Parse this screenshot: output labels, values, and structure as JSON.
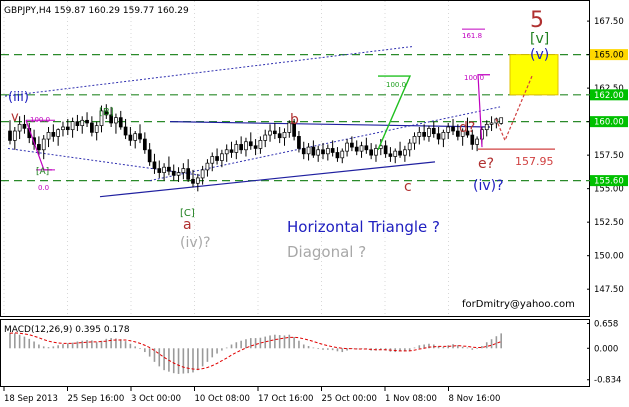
{
  "chart_data": {
    "type": "candlestick",
    "header": "GBPJPY,H4  159.87 160.29 159.77 160.29",
    "y_axis": {
      "min": 145.5,
      "max": 169.0,
      "ticks": [
        "167.50",
        "165.00",
        "162.50",
        "160.00",
        "157.50",
        "155.00",
        "152.50",
        "150.00",
        "147.50"
      ],
      "tick_values": [
        167.5,
        165.0,
        162.5,
        160.0,
        157.5,
        155.0,
        152.5,
        150.0,
        147.5
      ]
    },
    "x_axis": {
      "labels": [
        "18 Sep 2013",
        "25 Sep 16:00",
        "3 Oct 00:00",
        "10 Oct 08:00",
        "17 Oct 16:00",
        "25 Oct 00:00",
        "1 Nov 08:00",
        "8 Nov 16:00"
      ]
    },
    "price_tags": [
      {
        "value": 165.0,
        "text": "165.00",
        "color": "#ffd800"
      },
      {
        "value": 162.0,
        "text": "162.00",
        "color": "#00c000"
      },
      {
        "value": 160.0,
        "text": "160.00",
        "color": "#00c000"
      },
      {
        "value": 155.6,
        "text": "155.60",
        "color": "#00c000"
      }
    ],
    "price_series": [
      [
        0,
        159.3,
        160.1,
        158.3,
        158.6
      ],
      [
        1,
        158.6,
        159.6,
        157.9,
        159.3
      ],
      [
        2,
        159.3,
        160.4,
        158.7,
        159.8
      ],
      [
        3,
        159.8,
        160.5,
        159.1,
        159.5
      ],
      [
        4,
        159.5,
        159.9,
        158.4,
        158.8
      ],
      [
        5,
        158.8,
        159.4,
        157.9,
        158.3
      ],
      [
        6,
        158.3,
        158.9,
        157.5,
        157.9
      ],
      [
        7,
        157.9,
        159.0,
        157.2,
        158.7
      ],
      [
        8,
        158.7,
        159.6,
        158.1,
        159.2
      ],
      [
        9,
        159.2,
        159.8,
        158.5,
        158.9
      ],
      [
        10,
        158.9,
        159.5,
        158.2,
        159.4
      ],
      [
        11,
        159.4,
        160.0,
        158.9,
        159.6
      ],
      [
        12,
        159.6,
        160.2,
        159.0,
        159.4
      ],
      [
        13,
        159.4,
        160.3,
        158.8,
        160.0
      ],
      [
        14,
        160.0,
        160.5,
        159.3,
        159.7
      ],
      [
        15,
        159.7,
        160.4,
        159.1,
        160.1
      ],
      [
        16,
        160.1,
        160.7,
        159.6,
        159.9
      ],
      [
        17,
        159.9,
        160.4,
        158.9,
        159.2
      ],
      [
        18,
        159.2,
        160.0,
        158.6,
        159.7
      ],
      [
        19,
        159.7,
        161.2,
        159.2,
        160.8
      ],
      [
        20,
        160.8,
        161.3,
        160.2,
        160.5
      ],
      [
        21,
        160.5,
        161.1,
        159.6,
        159.9
      ],
      [
        22,
        159.9,
        160.6,
        159.1,
        160.3
      ],
      [
        23,
        160.3,
        160.8,
        159.4,
        159.6
      ],
      [
        24,
        159.6,
        160.2,
        158.7,
        159.0
      ],
      [
        25,
        159.0,
        159.6,
        158.2,
        158.6
      ],
      [
        26,
        158.6,
        159.3,
        158.0,
        159.1
      ],
      [
        27,
        159.1,
        159.8,
        158.4,
        158.7
      ],
      [
        28,
        158.7,
        159.2,
        157.6,
        157.9
      ],
      [
        29,
        157.9,
        158.4,
        156.7,
        157.0
      ],
      [
        30,
        157.0,
        157.6,
        156.1,
        156.5
      ],
      [
        31,
        156.5,
        157.1,
        155.8,
        156.2
      ],
      [
        32,
        156.2,
        156.9,
        155.6,
        156.6
      ],
      [
        33,
        156.6,
        157.4,
        156.0,
        156.3
      ],
      [
        34,
        156.3,
        156.8,
        155.6,
        156.0
      ],
      [
        35,
        156.0,
        156.6,
        155.5,
        156.2
      ],
      [
        36,
        156.2,
        156.9,
        155.7,
        156.5
      ],
      [
        37,
        156.5,
        157.2,
        155.5,
        155.7
      ],
      [
        38,
        155.7,
        156.4,
        155.1,
        155.4
      ],
      [
        39,
        155.4,
        156.1,
        154.8,
        155.8
      ],
      [
        40,
        155.8,
        156.7,
        155.3,
        156.4
      ],
      [
        41,
        156.4,
        157.2,
        155.9,
        156.9
      ],
      [
        42,
        156.9,
        157.7,
        156.3,
        157.4
      ],
      [
        43,
        157.4,
        158.0,
        156.8,
        157.1
      ],
      [
        44,
        157.1,
        157.9,
        156.6,
        157.6
      ],
      [
        45,
        157.6,
        158.3,
        157.0,
        157.9
      ],
      [
        46,
        157.9,
        158.5,
        157.3,
        157.7
      ],
      [
        47,
        157.7,
        158.6,
        157.2,
        158.3
      ],
      [
        48,
        158.3,
        158.9,
        157.6,
        157.9
      ],
      [
        49,
        157.9,
        158.8,
        157.4,
        158.5
      ],
      [
        50,
        158.5,
        159.2,
        157.9,
        158.2
      ],
      [
        51,
        158.2,
        158.7,
        157.5,
        158.0
      ],
      [
        52,
        158.0,
        158.9,
        157.6,
        158.6
      ],
      [
        53,
        158.6,
        159.4,
        158.1,
        159.0
      ],
      [
        54,
        159.0,
        159.8,
        158.5,
        159.3
      ],
      [
        55,
        159.3,
        159.9,
        158.7,
        159.1
      ],
      [
        56,
        159.1,
        159.6,
        158.4,
        158.8
      ],
      [
        57,
        158.8,
        159.5,
        158.2,
        159.2
      ],
      [
        58,
        159.2,
        160.1,
        158.8,
        159.9
      ],
      [
        59,
        159.9,
        160.2,
        158.6,
        158.9
      ],
      [
        60,
        158.9,
        159.3,
        157.7,
        158.0
      ],
      [
        61,
        158.0,
        158.5,
        157.2,
        157.6
      ],
      [
        62,
        157.6,
        158.4,
        157.1,
        158.1
      ],
      [
        63,
        158.1,
        158.6,
        157.3,
        157.5
      ],
      [
        64,
        157.5,
        158.2,
        157.0,
        157.9
      ],
      [
        65,
        157.9,
        158.4,
        157.2,
        157.6
      ],
      [
        66,
        157.6,
        158.3,
        157.1,
        158.0
      ],
      [
        67,
        158.0,
        158.6,
        157.4,
        157.7
      ],
      [
        68,
        157.7,
        158.1,
        157.0,
        157.3
      ],
      [
        69,
        157.3,
        158.0,
        156.9,
        157.8
      ],
      [
        70,
        157.8,
        158.7,
        157.4,
        158.4
      ],
      [
        71,
        158.4,
        158.9,
        157.8,
        158.1
      ],
      [
        72,
        158.1,
        158.6,
        157.5,
        157.8
      ],
      [
        73,
        157.8,
        158.5,
        157.3,
        158.2
      ],
      [
        74,
        158.2,
        158.8,
        157.6,
        157.9
      ],
      [
        75,
        157.9,
        158.4,
        157.2,
        157.5
      ],
      [
        76,
        157.5,
        158.3,
        157.0,
        158.0
      ],
      [
        77,
        158.0,
        158.7,
        157.5,
        158.2
      ],
      [
        78,
        158.2,
        158.6,
        157.3,
        157.6
      ],
      [
        79,
        157.6,
        158.1,
        157.0,
        157.4
      ],
      [
        80,
        157.4,
        158.0,
        156.9,
        157.8
      ],
      [
        81,
        157.8,
        158.5,
        157.3,
        157.5
      ],
      [
        82,
        157.5,
        158.2,
        157.0,
        157.9
      ],
      [
        83,
        157.9,
        158.7,
        157.4,
        158.4
      ],
      [
        84,
        158.4,
        159.2,
        157.9,
        158.9
      ],
      [
        85,
        158.9,
        159.6,
        158.3,
        159.2
      ],
      [
        86,
        159.2,
        159.8,
        158.6,
        158.9
      ],
      [
        87,
        158.9,
        159.7,
        158.5,
        159.5
      ],
      [
        88,
        159.5,
        160.0,
        158.8,
        159.1
      ],
      [
        89,
        159.1,
        159.6,
        158.3,
        158.7
      ],
      [
        90,
        158.7,
        159.4,
        158.1,
        159.2
      ],
      [
        91,
        159.2,
        159.9,
        158.7,
        159.6
      ],
      [
        92,
        159.6,
        160.2,
        159.0,
        159.3
      ],
      [
        93,
        159.3,
        159.8,
        158.6,
        158.9
      ],
      [
        94,
        158.9,
        159.5,
        158.2,
        159.3
      ],
      [
        95,
        159.3,
        160.3,
        158.8,
        159.0
      ],
      [
        96,
        159.0,
        159.4,
        157.9,
        158.3
      ],
      [
        97,
        158.3,
        158.9,
        157.8,
        158.7
      ],
      [
        98,
        158.7,
        159.6,
        158.3,
        159.4
      ],
      [
        99,
        159.4,
        160.1,
        158.9,
        159.8
      ],
      [
        100,
        159.8,
        160.4,
        159.3,
        159.9
      ],
      [
        101,
        159.9,
        160.3,
        159.5,
        160.2
      ],
      [
        102,
        159.87,
        160.29,
        159.77,
        160.29
      ]
    ],
    "macd": {
      "label": "MACD(12,26,9) 0.395 0.178",
      "min": -1.0,
      "max": 0.75,
      "ticks": [
        "0.658",
        "0.000",
        "-0.834"
      ],
      "tick_values": [
        0.658,
        0.0,
        -0.834
      ],
      "histogram": [
        0.42,
        0.4,
        0.36,
        0.31,
        0.25,
        0.18,
        0.1,
        0.05,
        0.03,
        0.05,
        0.08,
        0.11,
        0.13,
        0.15,
        0.18,
        0.2,
        0.22,
        0.21,
        0.16,
        0.2,
        0.25,
        0.27,
        0.26,
        0.24,
        0.19,
        0.12,
        0.05,
        -0.02,
        -0.1,
        -0.22,
        -0.36,
        -0.48,
        -0.58,
        -0.62,
        -0.66,
        -0.68,
        -0.67,
        -0.66,
        -0.64,
        -0.58,
        -0.48,
        -0.36,
        -0.24,
        -0.14,
        -0.06,
        0.02,
        0.1,
        0.16,
        0.2,
        0.24,
        0.27,
        0.27,
        0.28,
        0.31,
        0.34,
        0.36,
        0.35,
        0.34,
        0.36,
        0.3,
        0.2,
        0.1,
        0.06,
        0.02,
        -0.02,
        -0.04,
        -0.04,
        -0.05,
        -0.08,
        -0.1,
        -0.06,
        -0.02,
        -0.03,
        -0.02,
        -0.03,
        -0.06,
        -0.06,
        -0.04,
        -0.06,
        -0.09,
        -0.1,
        -0.08,
        -0.08,
        -0.06,
        0.02,
        0.08,
        0.1,
        0.12,
        0.1,
        0.06,
        0.04,
        0.08,
        0.11,
        0.08,
        0.04,
        0.02,
        -0.04,
        -0.02,
        0.06,
        0.16,
        0.24,
        0.32,
        0.395
      ],
      "signal": [
        0.4,
        0.41,
        0.4,
        0.38,
        0.36,
        0.32,
        0.28,
        0.23,
        0.19,
        0.16,
        0.14,
        0.13,
        0.13,
        0.13,
        0.14,
        0.15,
        0.16,
        0.17,
        0.17,
        0.18,
        0.19,
        0.21,
        0.22,
        0.22,
        0.22,
        0.2,
        0.17,
        0.13,
        0.08,
        0.02,
        -0.06,
        -0.15,
        -0.24,
        -0.32,
        -0.39,
        -0.45,
        -0.5,
        -0.53,
        -0.55,
        -0.56,
        -0.54,
        -0.51,
        -0.46,
        -0.4,
        -0.33,
        -0.26,
        -0.18,
        -0.11,
        -0.05,
        0.01,
        0.06,
        0.1,
        0.14,
        0.17,
        0.2,
        0.23,
        0.25,
        0.27,
        0.29,
        0.29,
        0.28,
        0.25,
        0.22,
        0.18,
        0.14,
        0.1,
        0.07,
        0.04,
        0.02,
        0.0,
        -0.01,
        -0.01,
        -0.02,
        -0.02,
        -0.02,
        -0.03,
        -0.04,
        -0.04,
        -0.04,
        -0.05,
        -0.06,
        -0.07,
        -0.07,
        -0.07,
        -0.05,
        -0.02,
        0.0,
        0.03,
        0.04,
        0.05,
        0.05,
        0.05,
        0.06,
        0.07,
        0.06,
        0.05,
        0.03,
        0.02,
        0.02,
        0.05,
        0.08,
        0.13,
        0.178
      ]
    },
    "annotations": [
      {
        "text": "(iii)",
        "color": "#2020c0"
      },
      {
        "text": "v",
        "color": "#b03030"
      },
      {
        "text": "100.0",
        "color": "#c000c0"
      },
      {
        "text": "[A]",
        "color": "#208020"
      },
      {
        "text": "0.0",
        "color": "#c000c0"
      },
      {
        "text": "[B]",
        "color": "#208020"
      },
      {
        "text": "[C]",
        "color": "#208020"
      },
      {
        "text": "a",
        "color": "#b03030"
      },
      {
        "text": "(iv)?",
        "color": "#a8a8a8"
      },
      {
        "text": "b",
        "color": "#b03030"
      },
      {
        "text": "c",
        "color": "#b03030"
      },
      {
        "text": "100.0",
        "color": "#20a020"
      },
      {
        "text": "d?",
        "color": "#b03030"
      },
      {
        "text": "e?",
        "color": "#b03030"
      },
      {
        "text": "(iv)?",
        "color": "#2020c0"
      },
      {
        "text": "157.95",
        "color": "#d04040"
      },
      {
        "text": "161.8",
        "color": "#c000c0"
      },
      {
        "text": "100.0",
        "color": "#c000c0"
      },
      {
        "text": "5",
        "color": "#b03030"
      },
      {
        "text": "[v]",
        "color": "#208020"
      },
      {
        "text": "(v)",
        "color": "#2020c0"
      },
      {
        "text": "Horizontal Triangle ?",
        "color": "#2020c0"
      },
      {
        "text": "Diagonal ?",
        "color": "#a8a8a8"
      },
      {
        "text": "forDmitry@yahoo.com",
        "color": "#000000"
      }
    ]
  }
}
